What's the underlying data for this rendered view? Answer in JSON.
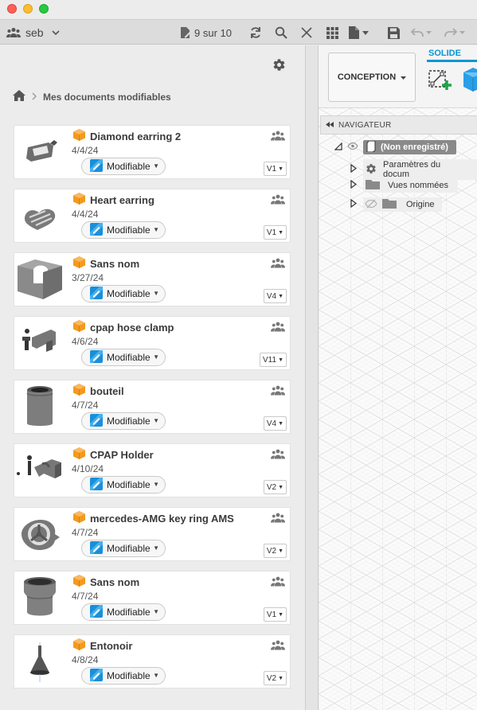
{
  "toolbar": {
    "user": "seb",
    "counter": "9 sur 10"
  },
  "breadcrumb": {
    "label": "Mes documents modifiables"
  },
  "documents": [
    {
      "title": "Diamond earring 2",
      "date": "4/4/24",
      "status": "Modifiable",
      "version": "V1",
      "thumb": "diamond-earring"
    },
    {
      "title": "Heart earring",
      "date": "4/4/24",
      "status": "Modifiable",
      "version": "V1",
      "thumb": "heart-earring"
    },
    {
      "title": "Sans nom",
      "date": "3/27/24",
      "status": "Modifiable",
      "version": "V4",
      "thumb": "bracket"
    },
    {
      "title": "cpap hose clamp",
      "date": "4/6/24",
      "status": "Modifiable",
      "version": "V11",
      "thumb": "hose-clamp"
    },
    {
      "title": "bouteil",
      "date": "4/7/24",
      "status": "Modifiable",
      "version": "V4",
      "thumb": "bottle"
    },
    {
      "title": "CPAP Holder",
      "date": "4/10/24",
      "status": "Modifiable",
      "version": "V2",
      "thumb": "cpap-holder"
    },
    {
      "title": "mercedes-AMG key ring AMS",
      "date": "4/7/24",
      "status": "Modifiable",
      "version": "V2",
      "thumb": "key-ring"
    },
    {
      "title": "Sans nom",
      "date": "4/7/24",
      "status": "Modifiable",
      "version": "V1",
      "thumb": "cylinder"
    },
    {
      "title": "Entonoir",
      "date": "4/8/24",
      "status": "Modifiable",
      "version": "V2",
      "thumb": "funnel"
    }
  ],
  "workspace": {
    "mode": "CONCEPTION",
    "tab": "SOLIDE"
  },
  "navigator": {
    "title": "NAVIGATEUR",
    "root": "(Non enregistré)",
    "items": [
      "Paramètres du docum",
      "Vues nommées",
      "Origine"
    ]
  },
  "colors": {
    "accent": "#0696d7",
    "part_icon": "#f39a1e",
    "title_red": "#fe5f57",
    "title_yellow": "#febc2e",
    "title_green": "#28c840"
  }
}
